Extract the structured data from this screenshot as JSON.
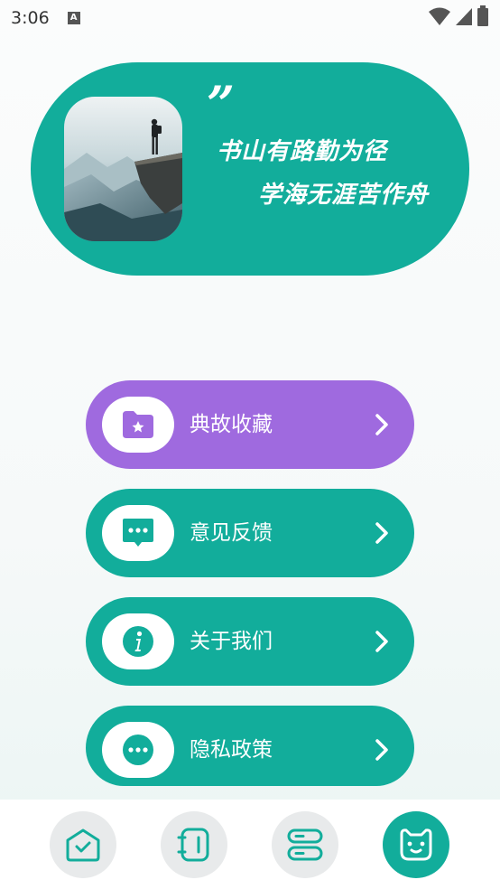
{
  "status_bar": {
    "time": "3:06",
    "notification_icon": "A"
  },
  "hero": {
    "quote_mark": "”",
    "line1": "书山有路勤为径",
    "line2": "学海无涯苦作舟",
    "image": "mountain-cliff-photo"
  },
  "menu": [
    {
      "label": "典故收藏",
      "icon": "folder-star-icon",
      "color": "#9f6adf"
    },
    {
      "label": "意见反馈",
      "icon": "chat-bubble-icon",
      "color": "#12ad9b"
    },
    {
      "label": "关于我们",
      "icon": "info-icon",
      "color": "#12ad9b"
    },
    {
      "label": "隐私政策",
      "icon": "more-dots-icon",
      "color": "#12ad9b"
    }
  ],
  "bottom_nav": [
    {
      "icon": "home-check-icon",
      "active": false
    },
    {
      "icon": "notebook-icon",
      "active": false
    },
    {
      "icon": "stack-icon",
      "active": false
    },
    {
      "icon": "cat-face-icon",
      "active": true
    }
  ],
  "colors": {
    "accent": "#12ad9b",
    "purple": "#9f6adf"
  }
}
